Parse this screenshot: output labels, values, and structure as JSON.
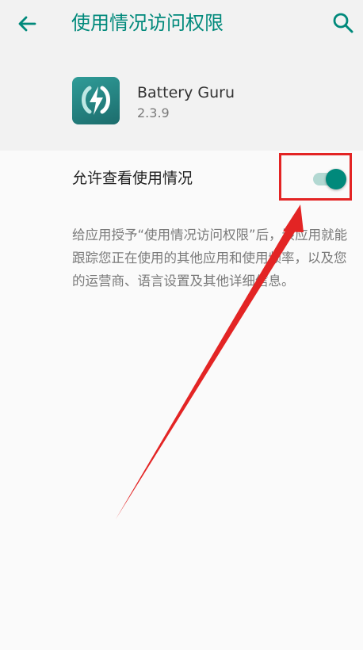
{
  "header": {
    "title": "使用情况访问权限",
    "back_icon": "arrow-left-icon",
    "search_icon": "search-icon"
  },
  "app": {
    "name": "Battery Guru",
    "version": "2.3.9",
    "icon": "battery-guru-app-icon"
  },
  "setting": {
    "label": "允许查看使用情况",
    "enabled": true,
    "description": "给应用授予“使用情况访问权限”后，该应用就能跟踪您正在使用的其他应用和使用频率，以及您的运营商、语言设置及其他详细信息。"
  },
  "colors": {
    "accent": "#00897b",
    "annotation": "#e32424"
  }
}
